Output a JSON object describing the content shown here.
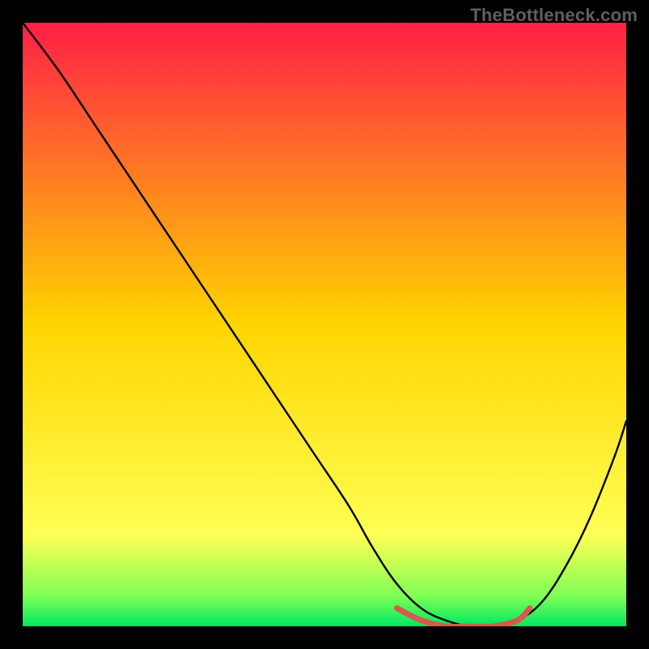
{
  "watermark": "TheBottleneck.com",
  "chart_data": {
    "type": "line",
    "title": "",
    "xlabel": "",
    "ylabel": "",
    "xlim": [
      0,
      100
    ],
    "ylim": [
      0,
      100
    ],
    "grid": false,
    "legend": false,
    "background_gradient": {
      "stops": [
        {
          "offset": 0.0,
          "color": "#ff1f47"
        },
        {
          "offset": 0.5,
          "color": "#ffd500"
        },
        {
          "offset": 0.85,
          "color": "#ffff55"
        },
        {
          "offset": 0.95,
          "color": "#7fff55"
        },
        {
          "offset": 1.0,
          "color": "#00e861"
        }
      ]
    },
    "series": [
      {
        "name": "bottleneck-curve",
        "color": "#000000",
        "x": [
          0,
          6,
          12,
          18,
          24,
          30,
          36,
          42,
          48,
          54,
          58,
          62,
          66,
          70,
          74,
          78,
          82,
          86,
          90,
          94,
          98,
          100
        ],
        "y": [
          100,
          92,
          83,
          74,
          65,
          56,
          47,
          38,
          29,
          20,
          13,
          7,
          3,
          1,
          0,
          0,
          1,
          4,
          10,
          18,
          28,
          34
        ]
      },
      {
        "name": "optimal-zone-marker",
        "color": "#d9584f",
        "x": [
          62,
          66,
          70,
          74,
          78,
          82,
          84
        ],
        "y": [
          3,
          1,
          0,
          0,
          0,
          1,
          3
        ]
      }
    ]
  }
}
